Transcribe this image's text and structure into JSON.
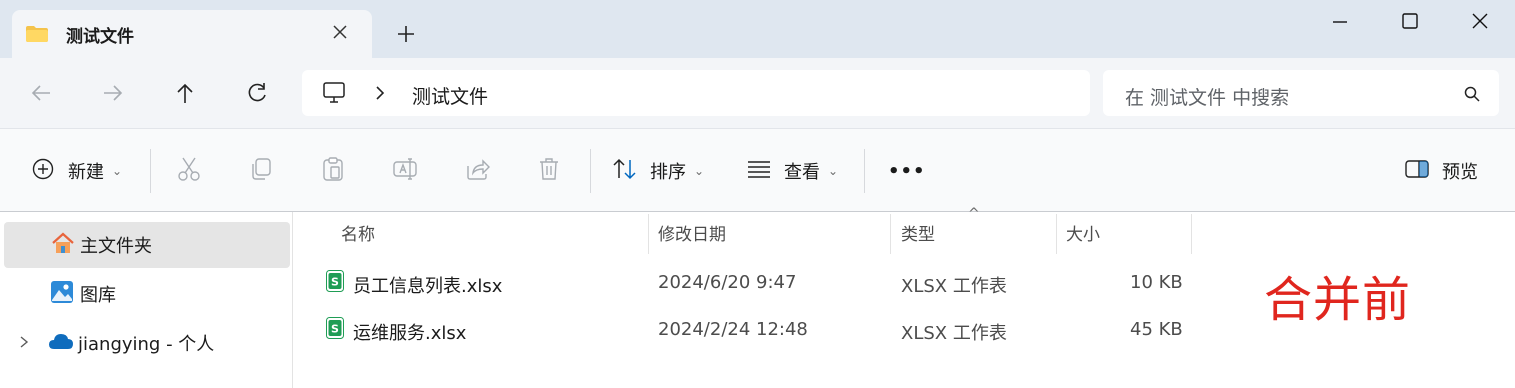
{
  "window": {
    "tab_title": "测试文件",
    "new_tab": "+"
  },
  "address": {
    "breadcrumb": "测试文件",
    "search_placeholder": "在 测试文件 中搜索"
  },
  "commands": {
    "new_label": "新建",
    "sort_label": "排序",
    "view_label": "查看",
    "more_label": "•••",
    "preview_label": "预览"
  },
  "sidebar": {
    "items": [
      {
        "label": "主文件夹",
        "icon": "home-icon",
        "selected": true
      },
      {
        "label": "图库",
        "icon": "gallery-icon",
        "selected": false
      },
      {
        "label": "jiangying - 个人",
        "icon": "onedrive-cloud-icon",
        "selected": false
      }
    ]
  },
  "columns": {
    "name": "名称",
    "modified": "修改日期",
    "type": "类型",
    "size": "大小",
    "sort_indicator": "^"
  },
  "files": [
    {
      "name": "员工信息列表.xlsx",
      "modified": "2024/6/20 9:47",
      "type": "XLSX 工作表",
      "size": "10 KB"
    },
    {
      "name": "运维服务.xlsx",
      "modified": "2024/2/24 12:48",
      "type": "XLSX 工作表",
      "size": "45 KB"
    }
  ],
  "annotation": "合并前",
  "colors": {
    "titlebar": "#dfe7f0",
    "accent": "#005fb8",
    "excel_green": "#1f9d55",
    "annotation_red": "#e0261e"
  }
}
